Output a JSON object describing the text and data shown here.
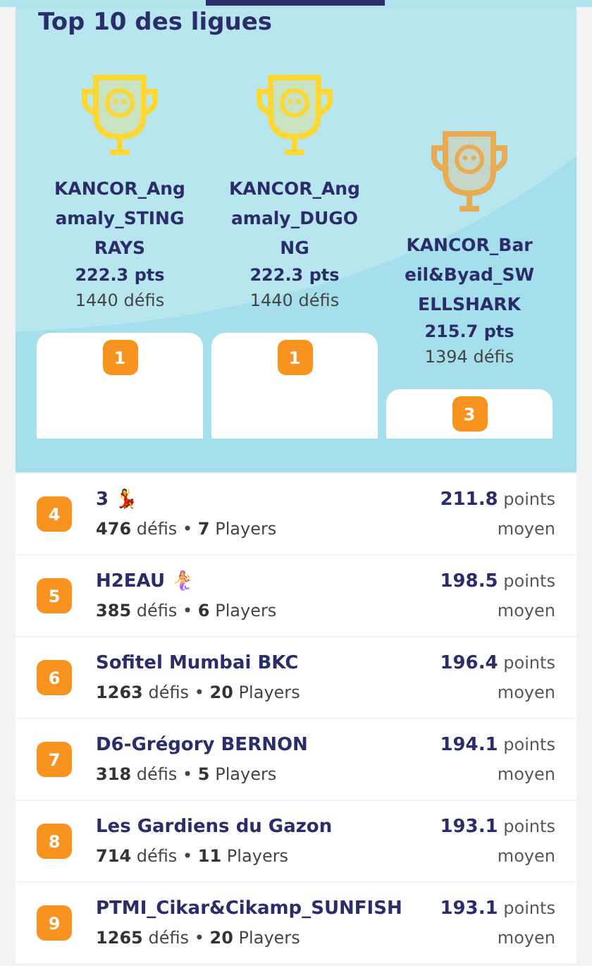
{
  "title": "Top 10 des ligues",
  "podium": [
    {
      "name": "KANCOR_Angamaly_STINGRAYS",
      "points": "222.3 pts",
      "challenges": "1440 défis",
      "rank": "1",
      "color": "#fdd835"
    },
    {
      "name": "KANCOR_Angamaly_DUGONG",
      "points": "222.3 pts",
      "challenges": "1440 défis",
      "rank": "1",
      "color": "#fdd835"
    },
    {
      "name": "KANCOR_Bareil&Byad_SWELLSHARK",
      "points": "215.7 pts",
      "challenges": "1394 défis",
      "rank": "3",
      "color": "#e8ac55"
    }
  ],
  "rows": [
    {
      "rank": "4",
      "name": "3 💃",
      "stats": "**476** défis • **7** Players",
      "score": "**211.8** points moyen"
    },
    {
      "rank": "5",
      "name": "H2EAU 🧜‍♀️",
      "stats": "**385** défis • **6** Players",
      "score": "**198.5** points moyen"
    },
    {
      "rank": "6",
      "name": "Sofitel Mumbai BKC",
      "stats": "**1263** défis • **20** Players",
      "score": "**196.4** points moyen"
    },
    {
      "rank": "7",
      "name": "D6-Grégory BERNON",
      "stats": "**318** défis • **5** Players",
      "score": "**194.1** points moyen"
    },
    {
      "rank": "8",
      "name": "Les Gardiens du Gazon",
      "stats": "**714** défis • **11** Players",
      "score": "**193.1** points moyen"
    },
    {
      "rank": "9",
      "name": "PTMI_Cikar&Cikamp_SUNFISH",
      "stats": "**1265** défis • **20** Players",
      "score": "**193.1** points moyen"
    }
  ]
}
